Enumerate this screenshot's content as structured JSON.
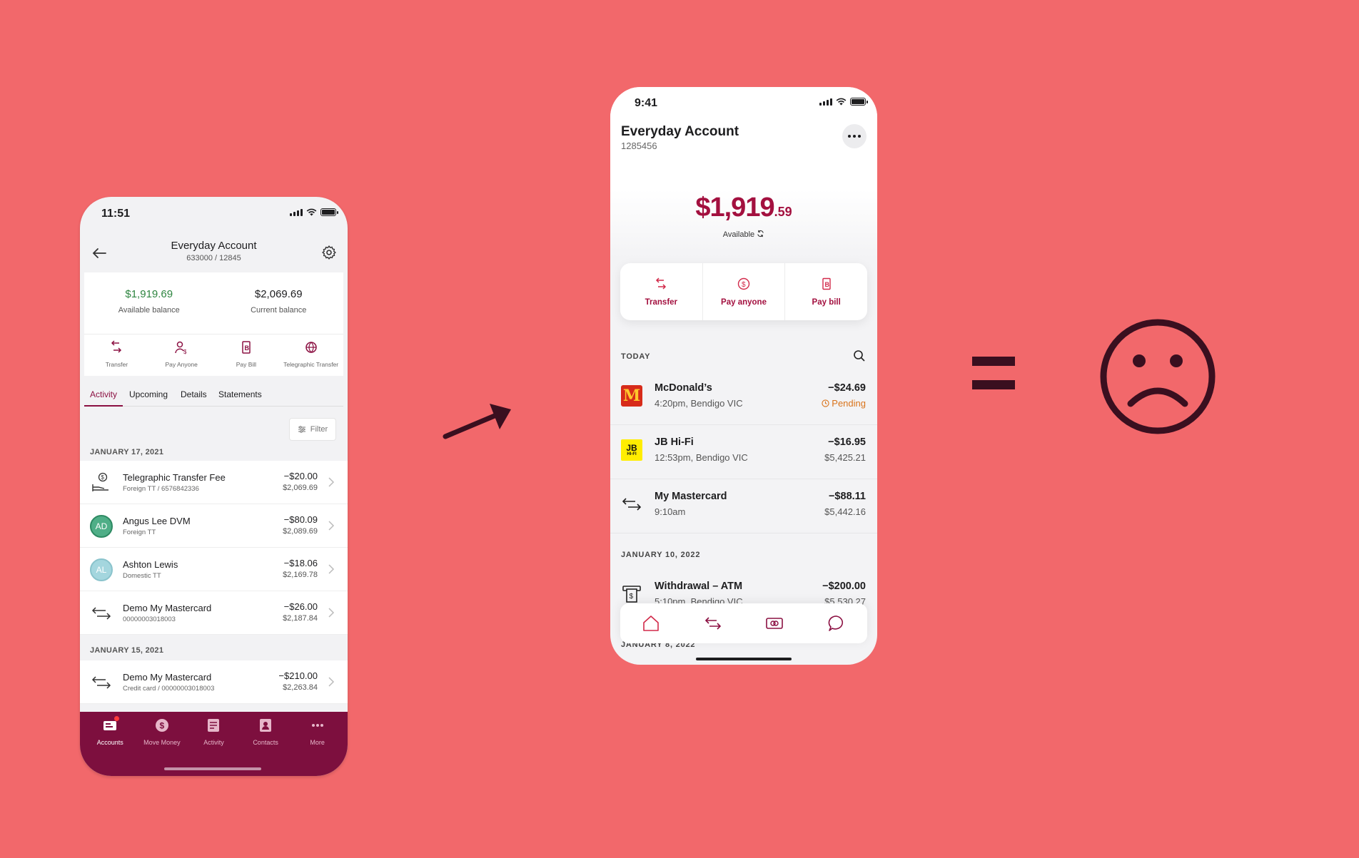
{
  "left_phone": {
    "status_time": "11:51",
    "header": {
      "title": "Everyday Account",
      "subtitle": "633000 / 12845"
    },
    "balances": {
      "available_amount": "$1,919.69",
      "available_label": "Available balance",
      "current_amount": "$2,069.69",
      "current_label": "Current balance"
    },
    "actions": [
      "Transfer",
      "Pay Anyone",
      "Pay Bill",
      "Telegraphic Transfer"
    ],
    "tabs": [
      "Activity",
      "Upcoming",
      "Details",
      "Statements"
    ],
    "filter_label": "Filter",
    "groups": [
      {
        "date": "JANUARY 17, 2021",
        "rows": [
          {
            "name": "Telegraphic Transfer Fee",
            "desc": "Foreign TT / 6576842336",
            "amount": "−$20.00",
            "balance": "$2,069.69",
            "icon": "fee-icon"
          },
          {
            "name": "Angus Lee DVM",
            "desc": "Foreign TT",
            "amount": "−$80.09",
            "balance": "$2,089.69",
            "initials": "AD"
          },
          {
            "name": "Ashton Lewis",
            "desc": "Domestic TT",
            "amount": "−$18.06",
            "balance": "$2,169.78",
            "initials": "AL"
          },
          {
            "name": "Demo My Mastercard",
            "desc": "00000003018003",
            "amount": "−$26.00",
            "balance": "$2,187.84",
            "icon": "transfer-icon"
          }
        ]
      },
      {
        "date": "JANUARY 15, 2021",
        "rows": [
          {
            "name": "Demo My Mastercard",
            "desc": "Credit card / 00000003018003",
            "amount": "−$210.00",
            "balance": "$2,263.84",
            "icon": "transfer-icon"
          }
        ]
      }
    ],
    "nav": [
      "Accounts",
      "Move Money",
      "Activity",
      "Contacts",
      "More"
    ]
  },
  "right_phone": {
    "status_time": "9:41",
    "title": "Everyday Account",
    "account_number": "1285456",
    "balance_dollars": "$1,919",
    "balance_cents": ".59",
    "available_label": "Available",
    "actions": [
      "Transfer",
      "Pay anyone",
      "Pay bill"
    ],
    "sections": [
      {
        "label": "TODAY",
        "rows": [
          {
            "name": "McDonald’s",
            "desc": "4:20pm, Bendigo VIC",
            "amount": "−$24.69",
            "status": "Pending"
          },
          {
            "name": "JB Hi-Fi",
            "desc": "12:53pm, Bendigo VIC",
            "amount": "−$16.95",
            "balance": "$5,425.21"
          },
          {
            "name": "My Mastercard",
            "desc": "9:10am",
            "amount": "−$88.11",
            "balance": "$5,442.16"
          }
        ]
      },
      {
        "label": "JANUARY 10, 2022",
        "rows": [
          {
            "name": "Withdrawal – ATM",
            "desc": "5:10pm, Bendigo VIC",
            "amount": "−$200.00",
            "balance": "$5,530.27"
          }
        ]
      },
      {
        "label": "JANUARY 8, 2022",
        "rows": []
      }
    ],
    "logos": {
      "mcdonalds": "M",
      "jbhifi_top": "JB",
      "jbhifi_bottom": "HI-FI"
    }
  },
  "colors": {
    "background": "#f2686b",
    "brand_left": "#7d0f3e",
    "brand_right": "#a3103f",
    "available_green": "#2e8540",
    "pending_orange": "#d9731a"
  }
}
